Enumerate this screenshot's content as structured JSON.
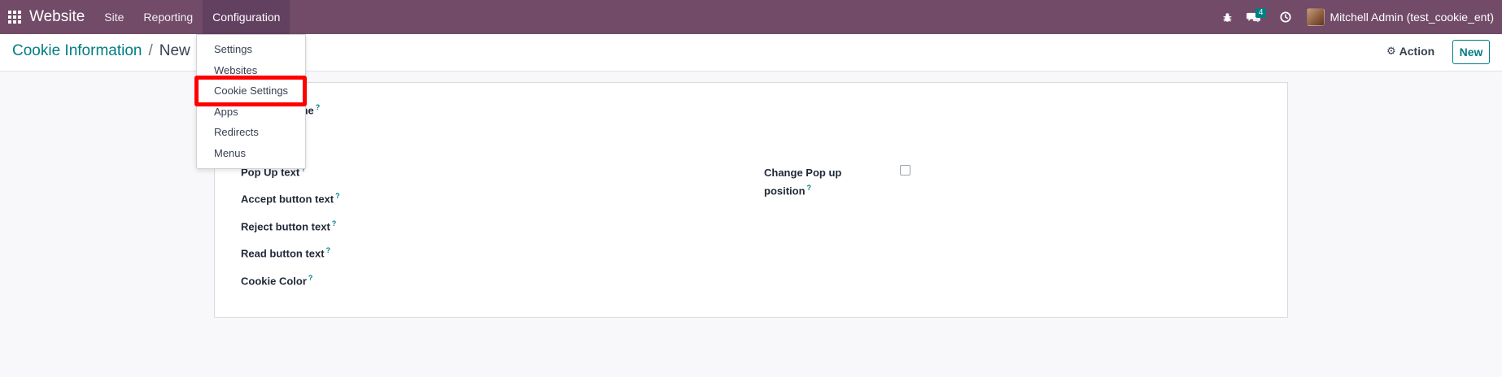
{
  "navbar": {
    "apps_icon": "apps-grid-icon",
    "brand": "Website",
    "menu": [
      {
        "label": "Site"
      },
      {
        "label": "Reporting"
      },
      {
        "label": "Configuration"
      }
    ],
    "bug_icon": "bug-icon",
    "chat_icon": "chat-bubbles-icon",
    "chat_count": "4",
    "clock_icon": "clock-icon",
    "user_name": "Mitchell Admin (test_cookie_ent)"
  },
  "control_panel": {
    "breadcrumb_parent": "Cookie Information",
    "breadcrumb_separator": "/",
    "breadcrumb_current": "New",
    "action_label": "Action",
    "action_icon": "gear-icon",
    "new_label": "New"
  },
  "dropdown": {
    "items": [
      {
        "label": "Settings"
      },
      {
        "label": "Websites"
      },
      {
        "label": "Cookie Settings"
      },
      {
        "label": "Apps"
      },
      {
        "label": "Redirects"
      },
      {
        "label": "Menus"
      }
    ]
  },
  "form": {
    "partial_label": "me",
    "popup_text_label": "Pop Up text",
    "accept_label": "Accept button text",
    "reject_label": "Reject button text",
    "read_label": "Read button text",
    "color_label": "Cookie Color",
    "position_label_line1": "Change Pop up",
    "position_label_line2": "position",
    "help_marker": "?",
    "position_checked": false
  },
  "colors": {
    "navbar": "#714b67",
    "accent": "#017e84",
    "highlight": "#ff0000"
  }
}
